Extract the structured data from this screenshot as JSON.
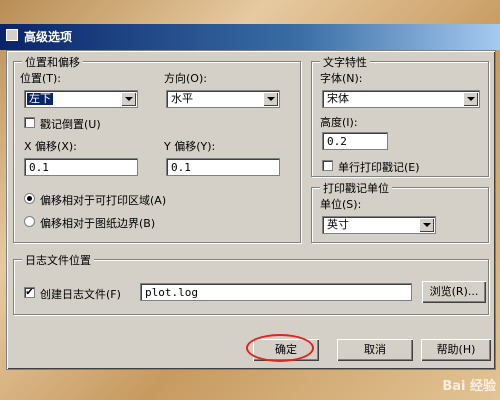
{
  "window": {
    "title": "高级选项"
  },
  "position_group": {
    "title": "位置和偏移",
    "position_label": "位置(T):",
    "position_value": "左下",
    "direction_label": "方向(O):",
    "direction_value": "水平",
    "invert_label": "戳记倒置(U)",
    "x_offset_label": "X 偏移(X):",
    "x_offset_value": "0.1",
    "y_offset_label": "Y 偏移(Y):",
    "y_offset_value": "0.1",
    "radio_printable": "偏移相对于可打印区域(A)",
    "radio_border": "偏移相对于图纸边界(B)"
  },
  "text_group": {
    "title": "文字特性",
    "font_label": "字体(N):",
    "font_value": "宋体",
    "height_label": "高度(I):",
    "height_value": "0.2",
    "single_line_label": "单行打印戳记(E)"
  },
  "units_group": {
    "title": "打印戳记单位",
    "units_label": "单位(S):",
    "units_value": "英寸"
  },
  "log_group": {
    "title": "日志文件位置",
    "create_label": "创建日志文件(F)",
    "file_value": "plot.log",
    "browse_label": "浏览(R)..."
  },
  "buttons": {
    "ok": "确定",
    "cancel": "取消",
    "help": "帮助(H)"
  },
  "watermark": "Bai 经验"
}
